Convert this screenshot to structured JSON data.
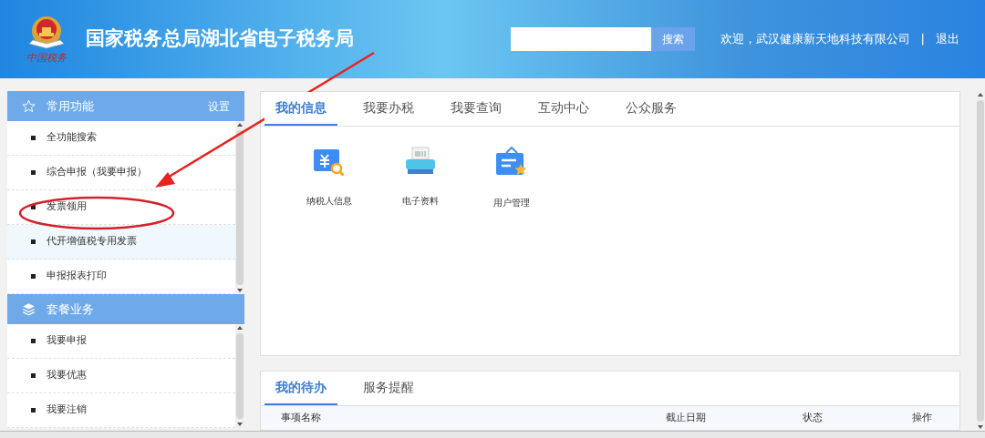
{
  "header": {
    "title": "国家税务总局湖北省电子税务局",
    "logo_caption": "中国税务",
    "search": {
      "button": "搜索"
    },
    "welcome": "欢迎，武汉健康新天地科技有限公司",
    "separator": "|",
    "logout": "退出"
  },
  "sidebar": {
    "sections": [
      {
        "kind": "star",
        "title": "常用功能",
        "action": "设置",
        "items": [
          {
            "label": "全功能搜索",
            "highlighted": false
          },
          {
            "label": "综合申报（我要申报）",
            "highlighted": false
          },
          {
            "label": "发票领用",
            "highlighted": false
          },
          {
            "label": "代开增值税专用发票",
            "highlighted": true
          },
          {
            "label": "申报报表打印",
            "highlighted": false
          }
        ]
      },
      {
        "kind": "layers",
        "title": "套餐业务",
        "items": [
          {
            "label": "我要申报",
            "highlighted": false
          },
          {
            "label": "我要优惠",
            "highlighted": false
          },
          {
            "label": "我要注销",
            "highlighted": false
          }
        ]
      }
    ]
  },
  "main": {
    "tabs": [
      {
        "label": "我的信息",
        "selected": true
      },
      {
        "label": "我要办税",
        "selected": false
      },
      {
        "label": "我要查询",
        "selected": false
      },
      {
        "label": "互动中心",
        "selected": false
      },
      {
        "label": "公众服务",
        "selected": false
      }
    ],
    "tiles": [
      {
        "kind": "receipt",
        "label": "纳税人信息"
      },
      {
        "kind": "printer",
        "label": "电子资料"
      },
      {
        "kind": "board",
        "label": "用户管理"
      }
    ]
  },
  "todo": {
    "tabs": [
      {
        "label": "我的待办",
        "selected": true
      },
      {
        "label": "服务提醒",
        "selected": false
      }
    ],
    "columns": [
      "事项名称",
      "截止日期",
      "状态",
      "操作"
    ]
  }
}
